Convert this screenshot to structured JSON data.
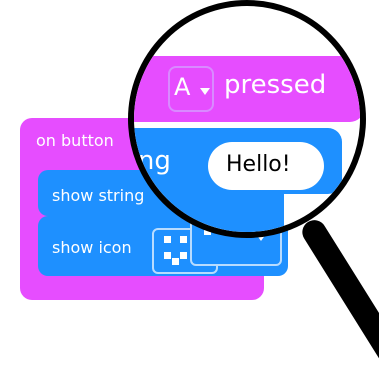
{
  "blocks": {
    "event_label": "on button",
    "show_string_label": "show string",
    "show_icon_label": "show icon"
  },
  "magnifier": {
    "key_value": "A",
    "pressed_label": "pressed",
    "string_label": "ring",
    "hello_value": "Hello!"
  },
  "colors": {
    "event_pink": "#e64dff",
    "basic_blue": "#1e90ff",
    "text_white": "#ffffff"
  }
}
